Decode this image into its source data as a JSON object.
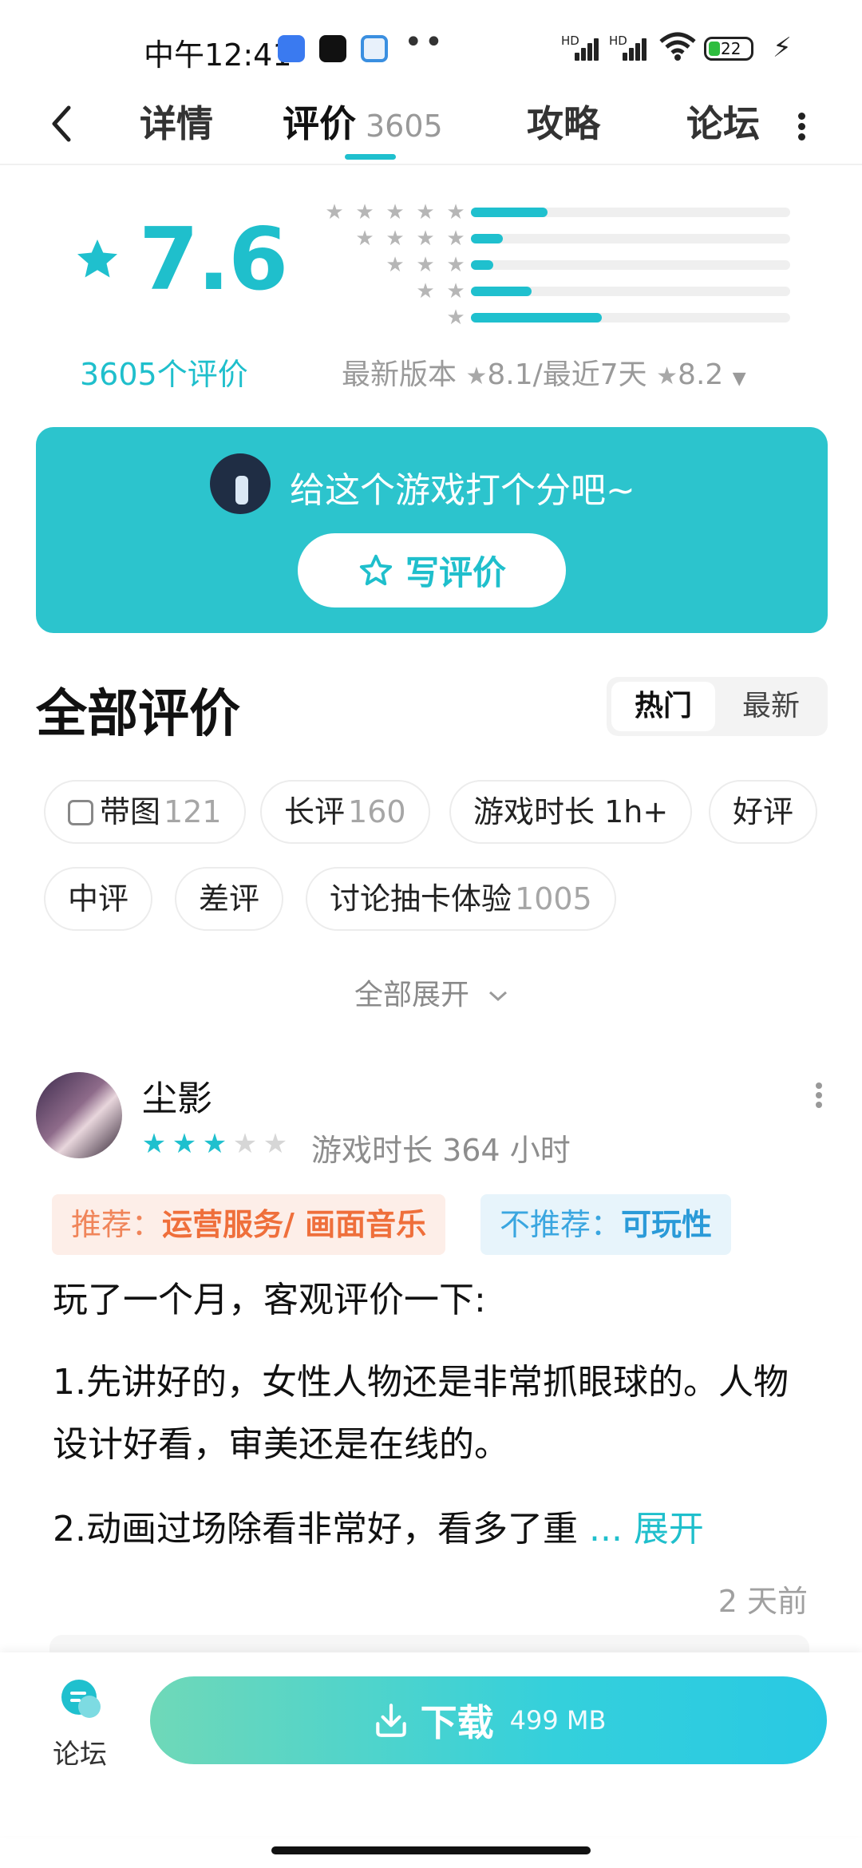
{
  "status_bar": {
    "time": "中午12:41",
    "signal_1": "HD",
    "signal_2": "HD",
    "battery": "22"
  },
  "nav": {
    "tabs": [
      {
        "label": "详情"
      },
      {
        "label": "评价",
        "count": "3605"
      },
      {
        "label": "攻略"
      },
      {
        "label": "论坛"
      }
    ],
    "active_tab": "评价"
  },
  "rating": {
    "score": "7.6",
    "count_label": "3605个评价",
    "distribution": [
      {
        "stars": 5,
        "fraction": 0.24
      },
      {
        "stars": 4,
        "fraction": 0.1
      },
      {
        "stars": 3,
        "fraction": 0.07
      },
      {
        "stars": 2,
        "fraction": 0.19
      },
      {
        "stars": 1,
        "fraction": 0.41
      }
    ],
    "version_label": "最新版本",
    "version_score": "8.1",
    "recent_label": "/最近7天",
    "recent_score": "8.2",
    "accent_color": "#1fc0ce"
  },
  "cta": {
    "prompt": "给这个游戏打个分吧~",
    "button": "写评价"
  },
  "reviews_section": {
    "title": "全部评价",
    "sort_hot": "热门",
    "sort_new": "最新",
    "filters": [
      {
        "label": "带图",
        "count": "121",
        "icon": "image-icon"
      },
      {
        "label": "长评",
        "count": "160"
      },
      {
        "label": "游戏时长 1h+",
        "count": ""
      },
      {
        "label": "好评",
        "count": ""
      },
      {
        "label": "中评",
        "count": ""
      },
      {
        "label": "差评",
        "count": ""
      },
      {
        "label": "讨论抽卡体验",
        "count": "1005"
      }
    ],
    "expand_all": "全部展开"
  },
  "review": {
    "author": "尘影",
    "rating": 3,
    "max_rating": 5,
    "playtime": "游戏时长 364 小时",
    "recommend_label": "推荐：",
    "recommend_value": "运营服务/ 画面音乐",
    "not_recommend_label": "不推荐：",
    "not_recommend_value": "可玩性",
    "p1": "玩了一个月，客观评价一下:",
    "p2": "1.先讲好的，女性人物还是非常抓眼球的。人物设计好看，审美还是在线的。",
    "p3": "2.动画过场除看非常好，看多了重",
    "more": "... 展开",
    "time": "2 天前"
  },
  "bottom_bar": {
    "forum_label": "论坛",
    "download_label": "下载",
    "download_size": "499 MB"
  }
}
